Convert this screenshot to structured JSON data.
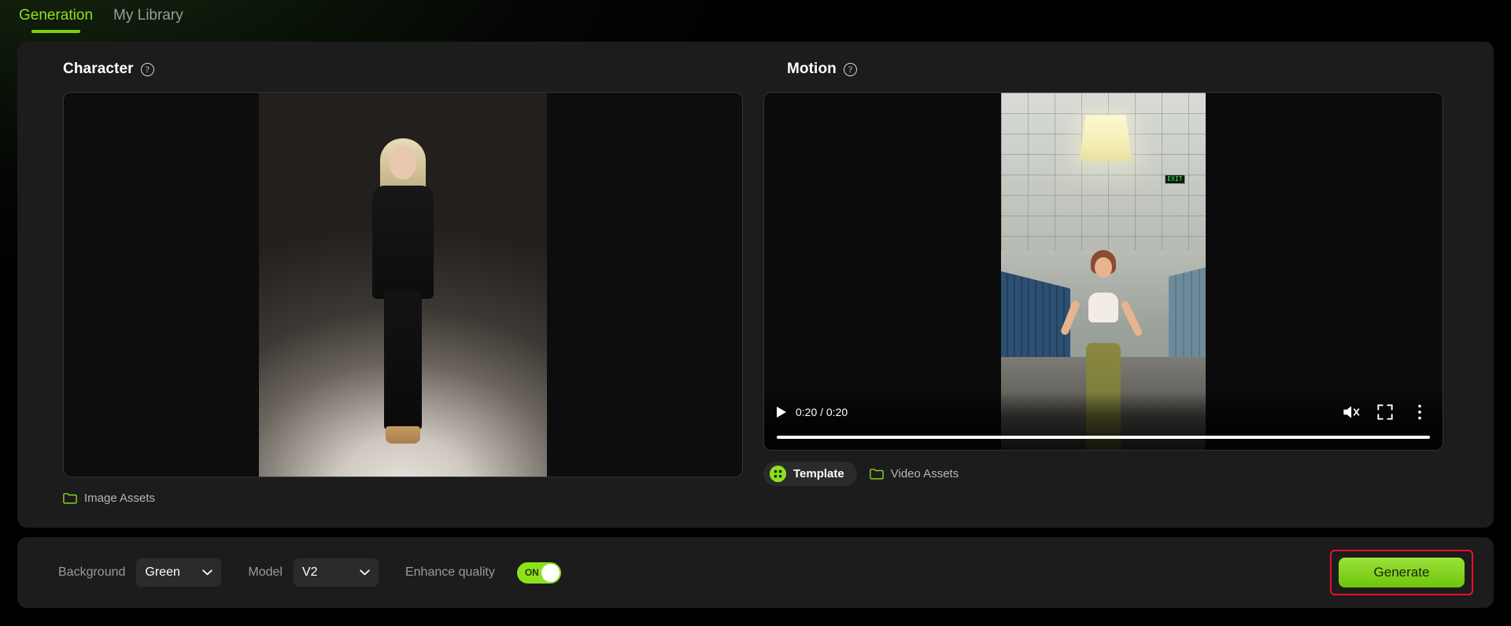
{
  "tabs": [
    {
      "label": "Generation",
      "active": true
    },
    {
      "label": "My Library",
      "active": false
    }
  ],
  "character": {
    "title": "Character",
    "help_icon": "question-mark-circle-icon",
    "assets_link": {
      "label": "Image Assets",
      "icon": "folder-icon"
    }
  },
  "motion": {
    "title": "Motion",
    "help_icon": "question-mark-circle-icon",
    "video": {
      "current_time": "0:20",
      "duration": "0:20",
      "time_display": "0:20 / 0:20",
      "progress_percent": 100,
      "play_icon": "play-icon",
      "mute_icon": "muted-volume-icon",
      "fullscreen_icon": "fullscreen-icon",
      "more_icon": "more-options-icon"
    },
    "actions": [
      {
        "label": "Template",
        "icon": "template-grid-icon",
        "selected": true
      },
      {
        "label": "Video Assets",
        "icon": "folder-icon",
        "selected": false
      }
    ]
  },
  "bottom_bar": {
    "background": {
      "label": "Background",
      "value": "Green",
      "chevron": "chevron-down-icon"
    },
    "model": {
      "label": "Model",
      "value": "V2",
      "chevron": "chevron-down-icon"
    },
    "enhance_quality": {
      "label": "Enhance quality",
      "state": "ON"
    },
    "generate_button": {
      "label": "Generate"
    }
  },
  "colors": {
    "accent_green": "#8fe01c",
    "button_green": "#7ed012",
    "highlight_red": "#e8122b",
    "panel_bg": "#1c1c1c",
    "page_bg": "#000000"
  }
}
